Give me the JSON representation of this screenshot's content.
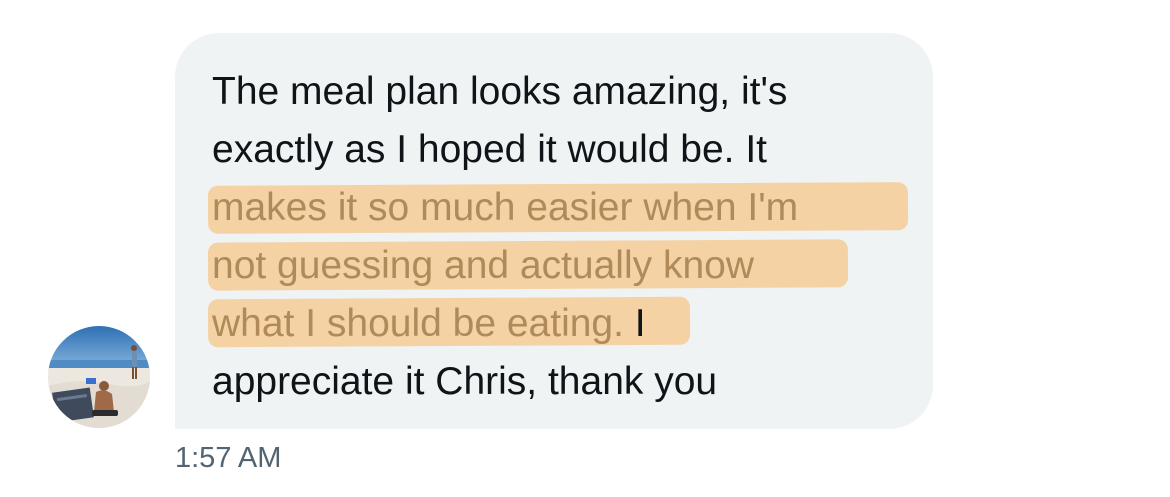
{
  "message": {
    "lines": [
      {
        "before": "The meal plan looks amazing, it's",
        "highlight": "",
        "after": ""
      },
      {
        "before": "exactly as I hoped it would be. It",
        "highlight": "",
        "after": ""
      },
      {
        "before": "",
        "highlight": "makes it so much easier when I'm",
        "after": ""
      },
      {
        "before": "",
        "highlight": "not guessing and actually know",
        "after": ""
      },
      {
        "before": "",
        "highlight": "what I should be eating.",
        "after": " I"
      },
      {
        "before": "appreciate it Chris, thank you",
        "highlight": "",
        "after": ""
      }
    ],
    "timestamp": "1:57 AM"
  },
  "colors": {
    "bubble": "#eff3f4",
    "text": "#0f1419",
    "highlight_marker": "#f5c78a",
    "highlight_text": "#b08a58",
    "timestamp": "#536471"
  },
  "avatar": {
    "icon": "beach-photo-avatar"
  }
}
